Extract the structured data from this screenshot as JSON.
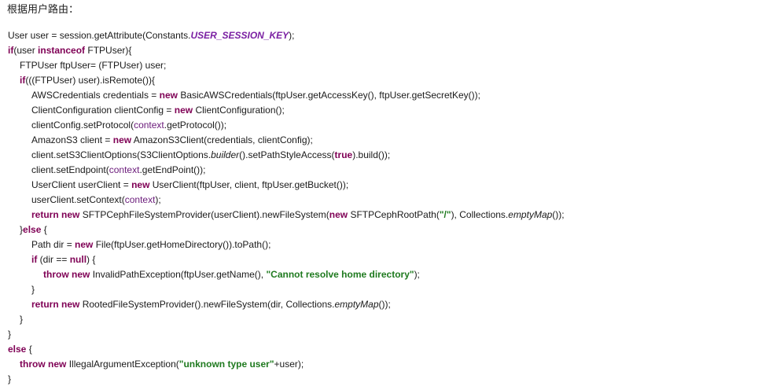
{
  "heading": "根据用户路由：",
  "code": {
    "language": "java",
    "lines": [
      {
        "indent": 0,
        "tokens": [
          {
            "t": "User user = session.getAttribute(Constants."
          },
          {
            "t": "USER_SESSION_KEY",
            "c": "const"
          },
          {
            "t": ");"
          }
        ]
      },
      {
        "indent": 0,
        "tokens": [
          {
            "t": "if",
            "c": "kw"
          },
          {
            "t": "(user "
          },
          {
            "t": "instanceof",
            "c": "kw"
          },
          {
            "t": " FTPUser){"
          }
        ]
      },
      {
        "indent": 1,
        "tokens": [
          {
            "t": "FTPUser ftpUser= (FTPUser) user;"
          }
        ]
      },
      {
        "indent": 1,
        "tokens": [
          {
            "t": "if",
            "c": "kw"
          },
          {
            "t": "(((FTPUser) user).isRemote()){"
          }
        ]
      },
      {
        "indent": 2,
        "tokens": [
          {
            "t": "AWSCredentials credentials = "
          },
          {
            "t": "new",
            "c": "kw"
          },
          {
            "t": " BasicAWSCredentials(ftpUser.getAccessKey(), ftpUser.getSecretKey());"
          }
        ]
      },
      {
        "indent": 2,
        "tokens": [
          {
            "t": "ClientConfiguration clientConfig = "
          },
          {
            "t": "new",
            "c": "kw"
          },
          {
            "t": " ClientConfiguration();"
          }
        ]
      },
      {
        "indent": 2,
        "tokens": [
          {
            "t": "clientConfig.setProtocol("
          },
          {
            "t": "context",
            "c": "fld"
          },
          {
            "t": ".getProtocol());"
          }
        ]
      },
      {
        "indent": 2,
        "tokens": [
          {
            "t": "AmazonS3 client = "
          },
          {
            "t": "new",
            "c": "kw"
          },
          {
            "t": " AmazonS3Client(credentials, clientConfig);"
          }
        ]
      },
      {
        "indent": 2,
        "tokens": [
          {
            "t": "client.setS3ClientOptions(S3ClientOptions."
          },
          {
            "t": "builder",
            "c": "it"
          },
          {
            "t": "().setPathStyleAccess("
          },
          {
            "t": "true",
            "c": "kw"
          },
          {
            "t": ").build());"
          }
        ]
      },
      {
        "indent": 2,
        "tokens": [
          {
            "t": "client.setEndpoint("
          },
          {
            "t": "context",
            "c": "fld"
          },
          {
            "t": ".getEndPoint());"
          }
        ]
      },
      {
        "indent": 2,
        "tokens": [
          {
            "t": "UserClient userClient = "
          },
          {
            "t": "new",
            "c": "kw"
          },
          {
            "t": " UserClient(ftpUser, client, ftpUser.getBucket());"
          }
        ]
      },
      {
        "indent": 2,
        "tokens": [
          {
            "t": "userClient.setContext("
          },
          {
            "t": "context",
            "c": "fld"
          },
          {
            "t": ");"
          }
        ]
      },
      {
        "indent": 2,
        "tokens": [
          {
            "t": "return",
            "c": "kw"
          },
          {
            "t": " "
          },
          {
            "t": "new",
            "c": "kw"
          },
          {
            "t": " SFTPCephFileSystemProvider(userClient).newFileSystem("
          },
          {
            "t": "new",
            "c": "kw"
          },
          {
            "t": " SFTPCephRootPath("
          },
          {
            "t": "\"/\"",
            "c": "str"
          },
          {
            "t": "), Collections."
          },
          {
            "t": "emptyMap",
            "c": "it"
          },
          {
            "t": "());"
          }
        ]
      },
      {
        "indent": 1,
        "tokens": [
          {
            "t": "}"
          },
          {
            "t": "else",
            "c": "kw"
          },
          {
            "t": " {"
          }
        ]
      },
      {
        "indent": 2,
        "tokens": [
          {
            "t": "Path dir = "
          },
          {
            "t": "new",
            "c": "kw"
          },
          {
            "t": " File(ftpUser.getHomeDirectory()).toPath();"
          }
        ]
      },
      {
        "indent": 2,
        "tokens": [
          {
            "t": "if",
            "c": "kw"
          },
          {
            "t": " (dir == "
          },
          {
            "t": "null",
            "c": "kw"
          },
          {
            "t": ") {"
          }
        ]
      },
      {
        "indent": 3,
        "tokens": [
          {
            "t": "throw",
            "c": "kw"
          },
          {
            "t": " "
          },
          {
            "t": "new",
            "c": "kw"
          },
          {
            "t": " InvalidPathException(ftpUser.getName(), "
          },
          {
            "t": "\"Cannot resolve home directory\"",
            "c": "str"
          },
          {
            "t": ");"
          }
        ]
      },
      {
        "indent": 2,
        "tokens": [
          {
            "t": "}"
          }
        ]
      },
      {
        "indent": 2,
        "tokens": [
          {
            "t": "return",
            "c": "kw"
          },
          {
            "t": " "
          },
          {
            "t": "new",
            "c": "kw"
          },
          {
            "t": " RootedFileSystemProvider().newFileSystem(dir, Collections."
          },
          {
            "t": "emptyMap",
            "c": "it"
          },
          {
            "t": "());"
          }
        ]
      },
      {
        "indent": 1,
        "tokens": [
          {
            "t": "}"
          }
        ]
      },
      {
        "indent": 0,
        "tokens": [
          {
            "t": "}"
          }
        ]
      },
      {
        "indent": 0,
        "tokens": [
          {
            "t": "else",
            "c": "kw"
          },
          {
            "t": " {"
          }
        ]
      },
      {
        "indent": 1,
        "tokens": [
          {
            "t": "throw",
            "c": "kw"
          },
          {
            "t": " "
          },
          {
            "t": "new",
            "c": "kw"
          },
          {
            "t": " IllegalArgumentException("
          },
          {
            "t": "\"unknown type user\"",
            "c": "str"
          },
          {
            "t": "+user);"
          }
        ]
      },
      {
        "indent": 0,
        "tokens": [
          {
            "t": "}"
          }
        ]
      }
    ]
  },
  "colors": {
    "keyword": "#7f0055",
    "constant": "#7a1fa2",
    "string": "#1f7a1f",
    "field": "#6a1a7a",
    "text": "#1a1a1a",
    "background": "#ffffff"
  }
}
